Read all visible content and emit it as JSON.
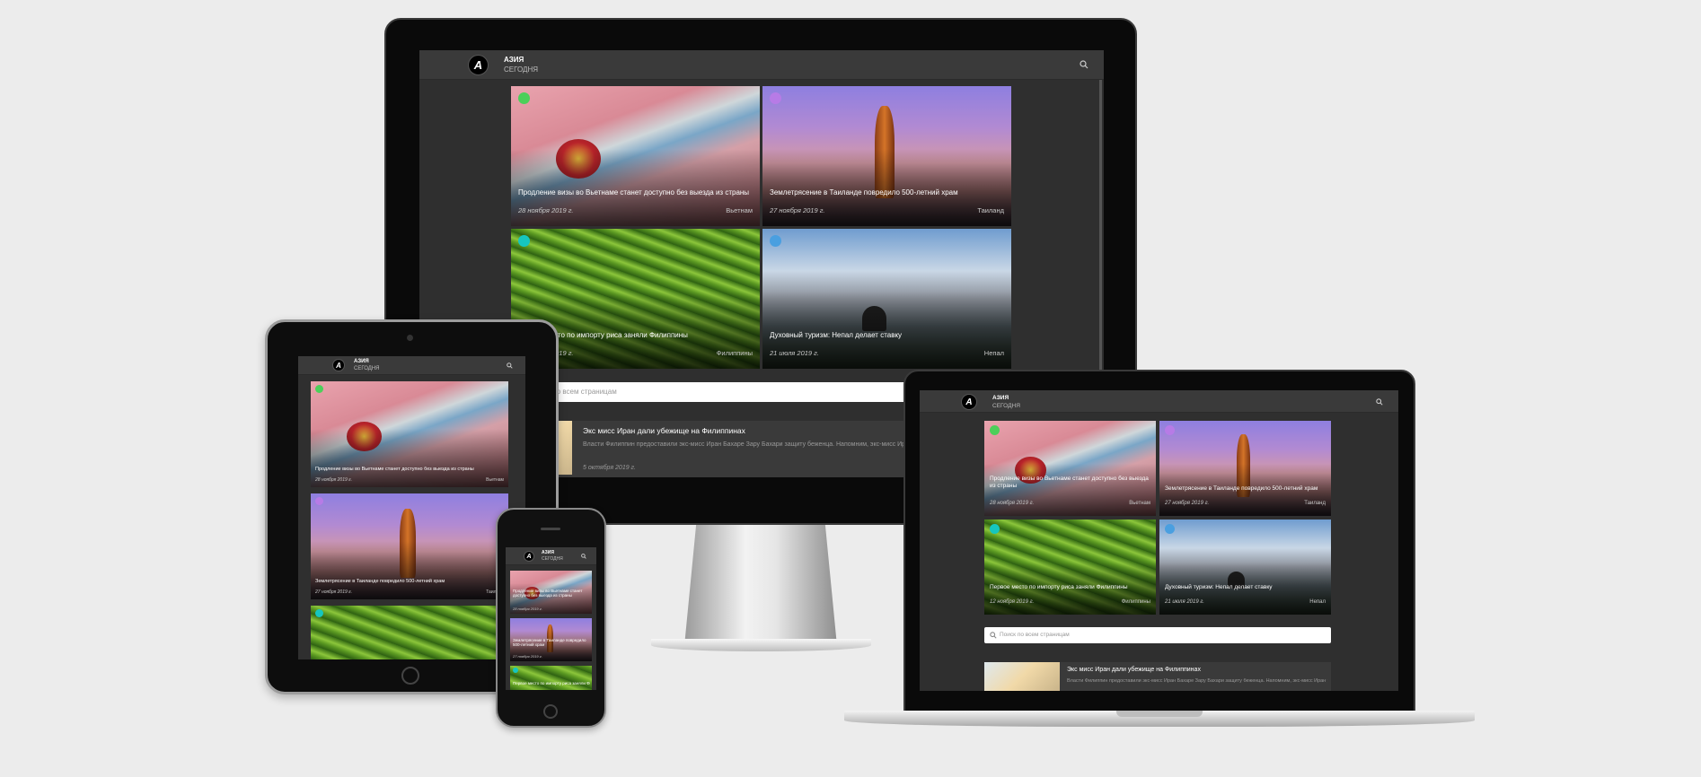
{
  "site": {
    "name": "АЗИЯ",
    "tagline": "СЕГОДНЯ",
    "logo_letter": "A"
  },
  "search": {
    "placeholder": "Поиск по всем страницам",
    "placeholder_partial": "всем страницам"
  },
  "cards": [
    {
      "title": "Продление визы во Вьетнаме станет доступно без выезда из страны",
      "date": "28 ноября 2019 г.",
      "category": "Вьетнам",
      "dot_color": "#4ccf5a",
      "image": "vietnam-visa"
    },
    {
      "title": "Землетрясение в Таиланде повредило 500-летний храм",
      "date": "27 ноября 2019 г.",
      "category": "Таиланд",
      "dot_color": "#b77be6",
      "image": "thailand-buddha"
    },
    {
      "title": "Первое место по импорту риса заняли Филиппины",
      "title_partial": "о по импорту риса заняли Филиппины",
      "date": "12 ноября 2019 г.",
      "date_partial": "19 г.",
      "category": "Филиппины",
      "dot_color": "#16c6bf",
      "image": "rice-terraces"
    },
    {
      "title": "Духовный туризм: Непал делает ставку",
      "date": "21 июля 2019 г.",
      "category": "Непал",
      "dot_color": "#4a9fe0",
      "image": "nepal-mountains"
    }
  ],
  "list_article": {
    "title": "Экс мисс Иран дали убежище на Филиппинах",
    "excerpt": "Власти Филиппин предоставили экс-мисс Иран Бахаре Зару Бахари защиту беженца. Напомним, экс-мисс Иран угрожало ... V...",
    "date": "5 октября 2019 г."
  },
  "devices": [
    "monitor",
    "tablet",
    "phone",
    "laptop"
  ],
  "colors": {
    "page_bg": "#ececec",
    "site_bg": "#2f2f2f",
    "header_bg": "#3a3a3a",
    "accent_dots": [
      "#4ccf5a",
      "#b77be6",
      "#16c6bf",
      "#4a9fe0"
    ]
  }
}
